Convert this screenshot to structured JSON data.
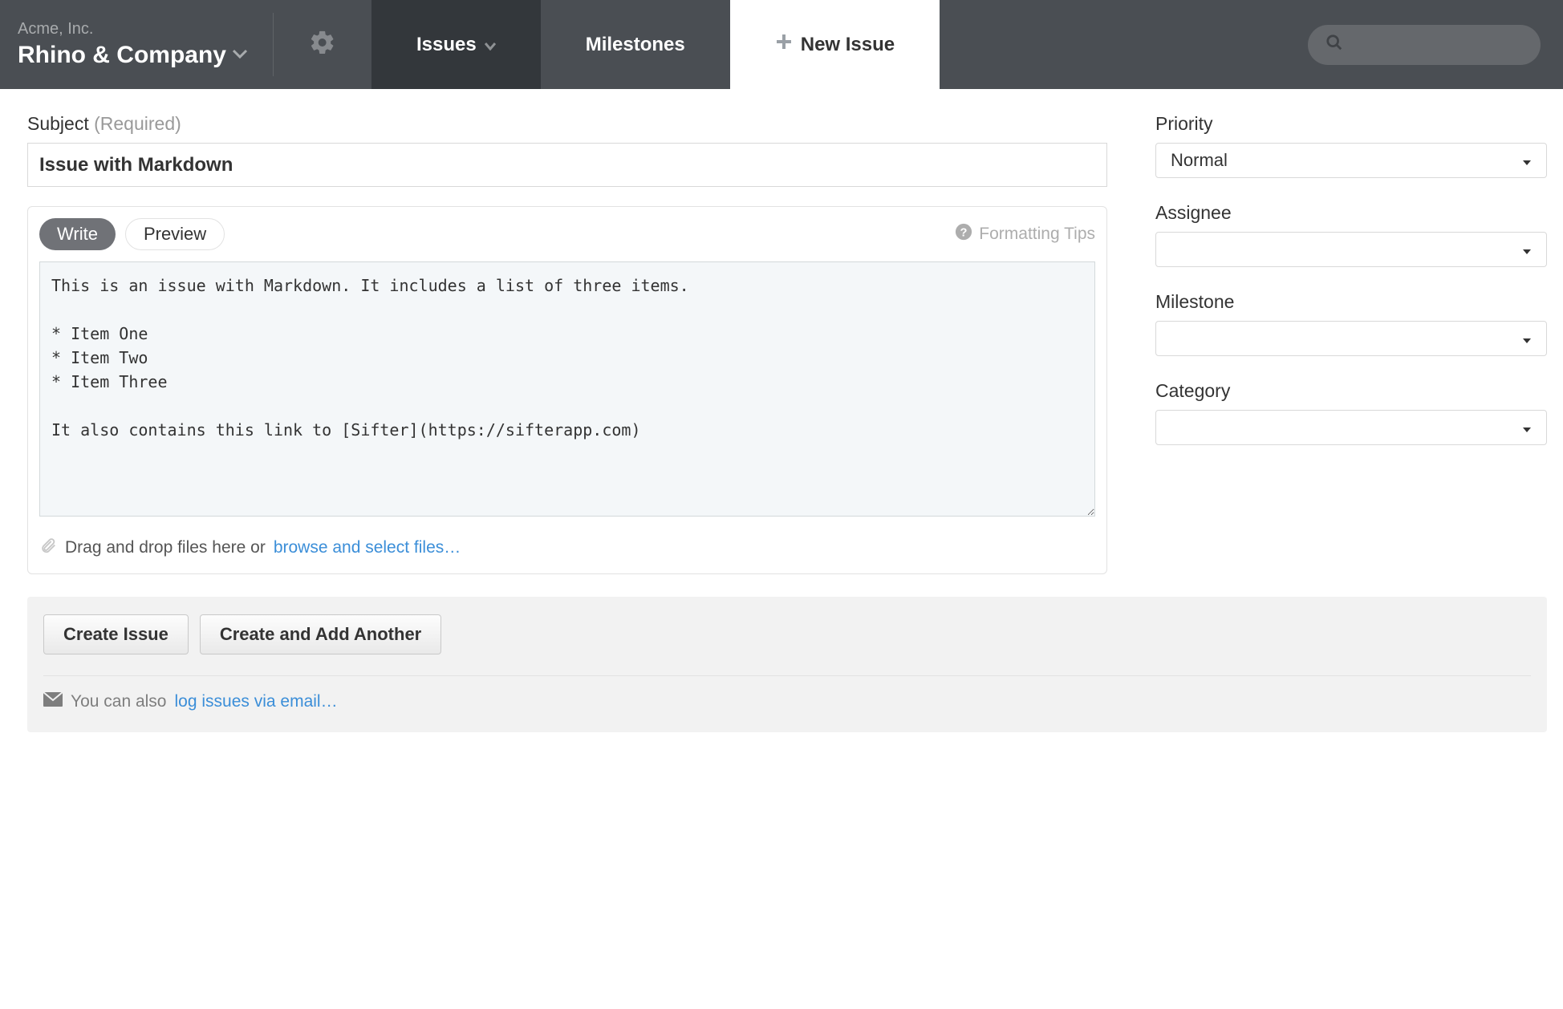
{
  "header": {
    "company": "Acme, Inc.",
    "project": "Rhino & Company",
    "nav": {
      "issues": "Issues",
      "milestones": "Milestones",
      "new_issue": "New Issue"
    }
  },
  "form": {
    "subject_label": "Subject",
    "subject_required": "(Required)",
    "subject_value": "Issue with Markdown",
    "write_label": "Write",
    "preview_label": "Preview",
    "formatting_tips": "Formatting Tips",
    "body_value": "This is an issue with Markdown. It includes a list of three items.\n\n* Item One\n* Item Two\n* Item Three\n\nIt also contains this link to [Sifter](https://sifterapp.com)",
    "attach_text": "Drag and drop files here or ",
    "browse_text": "browse and select files…"
  },
  "sidebar": {
    "priority_label": "Priority",
    "priority_value": "Normal",
    "assignee_label": "Assignee",
    "assignee_value": "",
    "milestone_label": "Milestone",
    "milestone_value": "",
    "category_label": "Category",
    "category_value": ""
  },
  "footer": {
    "create_issue": "Create Issue",
    "create_another": "Create and Add Another",
    "email_text": "You can also ",
    "email_link": "log issues via email…"
  }
}
